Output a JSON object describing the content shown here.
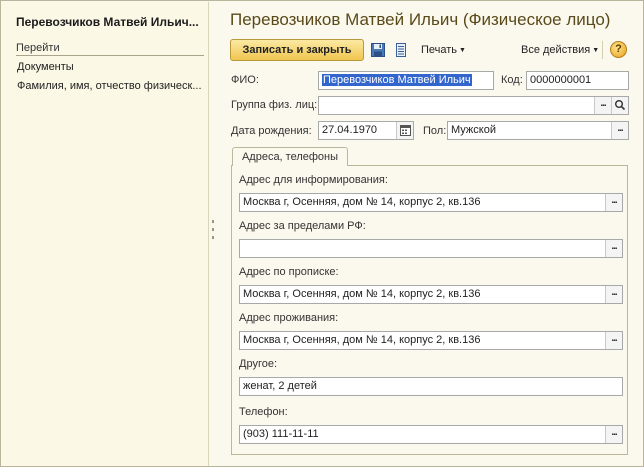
{
  "window": {
    "nav_title": "Перевозчиков Матвей Ильич...",
    "main_title": "Перевозчиков Матвей Ильич (Физическое лицо)"
  },
  "nav": {
    "section_label": "Перейти",
    "items": [
      {
        "label": "Документы"
      },
      {
        "label": "Фамилия, имя, отчество физическ..."
      }
    ]
  },
  "toolbar": {
    "save_close_label": "Записать и закрыть",
    "print_label": "Печать",
    "all_actions_label": "Все действия",
    "help_label": "?",
    "icons": [
      "save-icon",
      "document-list-icon",
      "help-icon"
    ]
  },
  "form": {
    "fio_label": "ФИО:",
    "fio_value": "Перевозчиков Матвей Ильич",
    "code_label": "Код:",
    "code_value": "0000000001",
    "group_label": "Группа физ. лиц:",
    "group_value": "",
    "birth_label": "Дата рождения:",
    "birth_value": "27.04.1970",
    "gender_label": "Пол:",
    "gender_value": "Мужской"
  },
  "tabs": [
    {
      "label": "Адреса, телефоны"
    }
  ],
  "addresses": {
    "info_label": "Адрес для информирования:",
    "info_value": "Москва г, Осенняя, дом № 14, корпус 2, кв.136",
    "abroad_label": "Адрес за пределами РФ:",
    "abroad_value": "",
    "registration_label": "Адрес по прописке:",
    "registration_value": "Москва г, Осенняя, дом № 14, корпус 2, кв.136",
    "residence_label": "Адрес проживания:",
    "residence_value": "Москва г, Осенняя, дом № 14, корпус 2, кв.136",
    "other_label": "Другое:",
    "other_value": "женат, 2 детей",
    "phone_label": "Телефон:",
    "phone_value": "(903) 111-11-11"
  },
  "colors": {
    "background": "#fbf9ee",
    "title": "#5a4a1a",
    "primary_button": "#f0c650",
    "selection": "#3366cc"
  }
}
